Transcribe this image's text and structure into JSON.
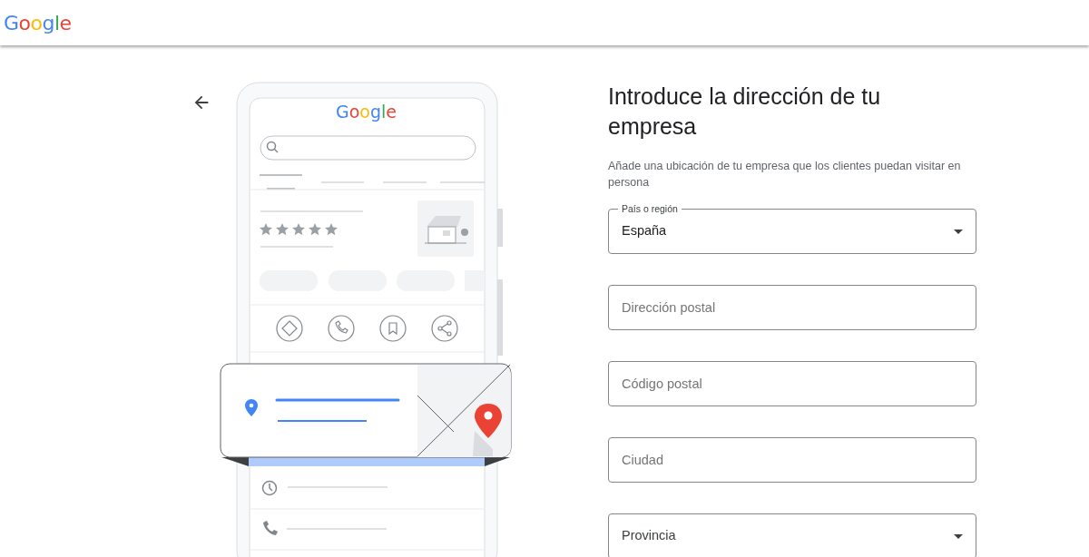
{
  "header": {
    "logo": "Google"
  },
  "illustration": {
    "logo": "Google"
  },
  "title": "Introduce la dirección de tu empresa",
  "subtitle": "Añade una ubicación de tu empresa que los clientes puedan visitar en persona",
  "fields": [
    {
      "kind": "select",
      "label": "País o región",
      "value": "España"
    },
    {
      "kind": "text",
      "placeholder": "Dirección postal"
    },
    {
      "kind": "text",
      "placeholder": "Código postal"
    },
    {
      "kind": "text",
      "placeholder": "Ciudad"
    },
    {
      "kind": "select",
      "placeholder": "Provincia"
    }
  ]
}
